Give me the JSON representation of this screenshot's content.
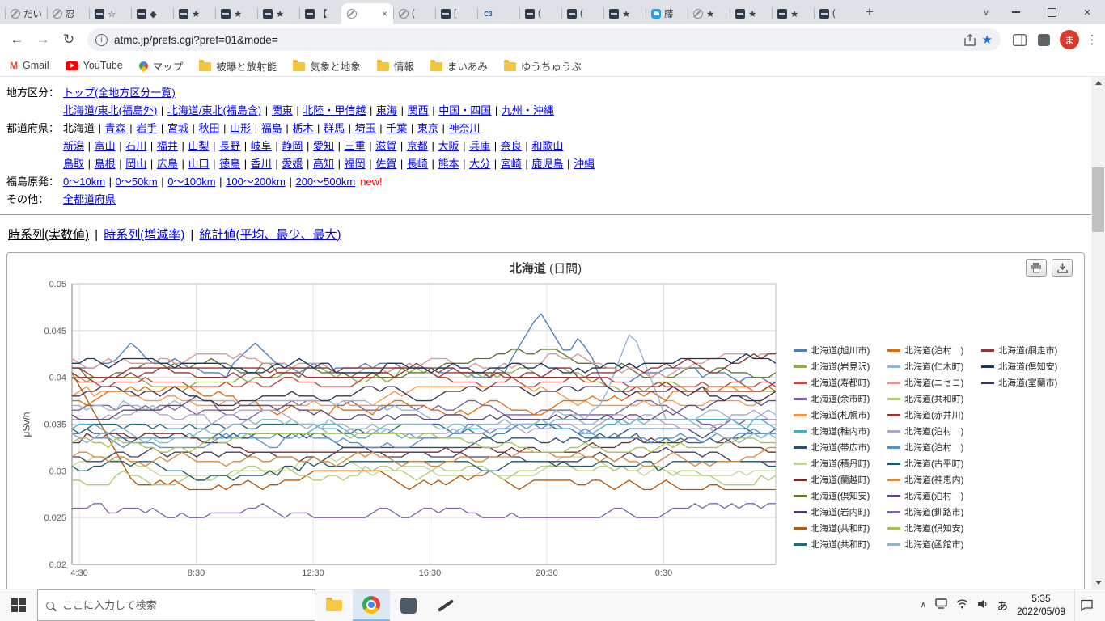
{
  "browser": {
    "window_controls": {
      "close": "×",
      "tab_chevron": "∨"
    },
    "glyphs": {
      "back": "←",
      "forward": "→",
      "reload": "↻",
      "star": "★",
      "new_tab": "+",
      "close_tab": "×"
    },
    "url": "atmc.jp/prefs.cgi?pref=01&mode=",
    "avatar_text": "ま",
    "tabs": [
      {
        "icon": "globe",
        "label": "だい",
        "active": false
      },
      {
        "icon": "globe",
        "label": "忍",
        "active": false
      },
      {
        "icon": "board",
        "label": "☆",
        "active": false
      },
      {
        "icon": "board",
        "label": "◆",
        "active": false
      },
      {
        "icon": "board",
        "label": "★",
        "active": false
      },
      {
        "icon": "board",
        "label": "★",
        "active": false
      },
      {
        "icon": "board",
        "label": "★",
        "active": false
      },
      {
        "icon": "board",
        "label": "【",
        "active": false
      },
      {
        "icon": "globe",
        "label": "",
        "active": true
      },
      {
        "icon": "globe",
        "label": "(",
        "active": false
      },
      {
        "icon": "board",
        "label": "[",
        "active": false
      },
      {
        "icon": "c3",
        "label": "C3",
        "active": false
      },
      {
        "icon": "board",
        "label": "(",
        "active": false
      },
      {
        "icon": "board",
        "label": "(",
        "active": false
      },
      {
        "icon": "board",
        "label": "★",
        "active": false
      },
      {
        "icon": "twitter",
        "label": "藤",
        "active": false
      },
      {
        "icon": "globe",
        "label": "★",
        "active": false
      },
      {
        "icon": "board",
        "label": "★",
        "active": false
      },
      {
        "icon": "board",
        "label": "★",
        "active": false
      },
      {
        "icon": "board",
        "label": "(",
        "active": false
      }
    ],
    "bookmarks": [
      {
        "icon": "gmail",
        "label": "Gmail"
      },
      {
        "icon": "youtube",
        "label": "YouTube"
      },
      {
        "icon": "maps",
        "label": "マップ"
      },
      {
        "icon": "folder",
        "label": "被曝と放射能"
      },
      {
        "icon": "folder",
        "label": "気象と地象"
      },
      {
        "icon": "folder",
        "label": "情報"
      },
      {
        "icon": "folder",
        "label": "まいあみ"
      },
      {
        "icon": "folder",
        "label": "ゆうちゅうぶ"
      }
    ]
  },
  "page": {
    "region": {
      "label": "地方区分：",
      "line1": [
        "トップ(全地方区分一覧)"
      ],
      "line2": [
        "北海道/東北(福島外)",
        "北海道/東北(福島含)",
        "関東",
        "北陸・甲信越",
        "東海",
        "関西",
        "中国・四国",
        "九州・沖縄"
      ]
    },
    "pref": {
      "label": "都道府県：",
      "current": "北海道",
      "lines": [
        [
          "北海道",
          "青森",
          "岩手",
          "宮城",
          "秋田",
          "山形",
          "福島",
          "栃木",
          "群馬",
          "埼玉",
          "千葉",
          "東京",
          "神奈川"
        ],
        [
          "新潟",
          "富山",
          "石川",
          "福井",
          "山梨",
          "長野",
          "岐阜",
          "静岡",
          "愛知",
          "三重",
          "滋賀",
          "京都",
          "大阪",
          "兵庫",
          "奈良",
          "和歌山"
        ],
        [
          "鳥取",
          "島根",
          "岡山",
          "広島",
          "山口",
          "徳島",
          "香川",
          "愛媛",
          "高知",
          "福岡",
          "佐賀",
          "長崎",
          "熊本",
          "大分",
          "宮崎",
          "鹿児島",
          "沖縄"
        ]
      ]
    },
    "npp": {
      "label": "福島原発：",
      "links": [
        "0〜10km",
        "0〜50km",
        "0〜100km",
        "100〜200km",
        "200〜500km"
      ],
      "badge": "new!"
    },
    "other": {
      "label": "その他：",
      "links": [
        "全都道府県"
      ]
    },
    "views": {
      "current": "時系列(実数値)",
      "items": [
        "時系列(実数値)",
        "時系列(増減率)",
        "統計値(平均、最少、最大)"
      ]
    }
  },
  "chart_data": {
    "type": "line",
    "title": "北海道",
    "subtitle": "(日間)",
    "ylabel": "μSv/h",
    "ylim": [
      0.02,
      0.05
    ],
    "yticks": [
      0.05,
      0.045,
      0.04,
      0.035,
      0.03,
      0.025,
      0.02
    ],
    "xticks": [
      "4:30",
      "8:30",
      "12:30",
      "16:30",
      "20:30",
      "0:30"
    ],
    "x_hours_span": 24,
    "grid": true,
    "legend_position": "right",
    "legend_rows": 13,
    "series": [
      {
        "name": "北海道(旭川市)",
        "color": "#4E7CBF",
        "base": 0.0408,
        "amp": 0.0013,
        "peaks": [
          {
            "t": 0.085,
            "v": 0.0438,
            "w": 0.035
          },
          {
            "t": 0.26,
            "v": 0.0437,
            "w": 0.04
          },
          {
            "t": 0.665,
            "v": 0.047,
            "w": 0.05
          },
          {
            "t": 0.72,
            "v": 0.0443,
            "w": 0.03
          }
        ]
      },
      {
        "name": "北海道(岩見沢)",
        "color": "#8FAF4C",
        "base": 0.0398,
        "amp": 0.0012
      },
      {
        "name": "北海道(寿都町)",
        "color": "#BE4B48",
        "base": 0.0405,
        "amp": 0.0014
      },
      {
        "name": "北海道(余市町)",
        "color": "#7D60A0",
        "base": 0.036,
        "amp": 0.0013
      },
      {
        "name": "北海道(札幌市)",
        "color": "#F79646",
        "base": 0.038,
        "amp": 0.0012
      },
      {
        "name": "北海道(稚内市)",
        "color": "#4BACC6",
        "base": 0.0345,
        "amp": 0.0012
      },
      {
        "name": "北海道(帯広市)",
        "color": "#2C4D75",
        "base": 0.0335,
        "amp": 0.0012
      },
      {
        "name": "北海道(積丹町)",
        "color": "#C3D69B",
        "base": 0.0305,
        "amp": 0.001
      },
      {
        "name": "北海道(蘭越町)",
        "color": "#772C2A",
        "base": 0.033,
        "amp": 0.0012
      },
      {
        "name": "北海道(倶知安)",
        "color": "#5F7530",
        "base": 0.0415,
        "amp": 0.0013
      },
      {
        "name": "北海道(岩内町)",
        "color": "#4D3B62",
        "base": 0.032,
        "amp": 0.0012
      },
      {
        "name": "北海道(共和町)",
        "color": "#B65708",
        "base": 0.029,
        "amp": 0.001,
        "peaks": [
          {
            "t": 0.0,
            "v": 0.0405,
            "w": 0.085
          }
        ]
      },
      {
        "name": "北海道(共和町)",
        "color": "#276A7C",
        "base": 0.034,
        "amp": 0.0011
      },
      {
        "name": "北海道(泊村　)",
        "color": "#E36C0A",
        "base": 0.0375,
        "amp": 0.0013
      },
      {
        "name": "北海道(仁木町)",
        "color": "#95B3D7",
        "base": 0.0365,
        "amp": 0.0012,
        "peaks": [
          {
            "t": 0.795,
            "v": 0.0452,
            "w": 0.045
          }
        ]
      },
      {
        "name": "北海道(ニセコ)",
        "color": "#D99694",
        "base": 0.0412,
        "amp": 0.0012
      },
      {
        "name": "北海道(共和町)",
        "color": "#AFC97A",
        "base": 0.0295,
        "amp": 0.0008
      },
      {
        "name": "北海道(赤井川)",
        "color": "#943634",
        "base": 0.0398,
        "amp": 0.0013
      },
      {
        "name": "北海道(泊村　)",
        "color": "#B2A2C7",
        "base": 0.0352,
        "amp": 0.0012
      },
      {
        "name": "北海道(泊村　)",
        "color": "#558ED5",
        "base": 0.0338,
        "amp": 0.0012
      },
      {
        "name": "北海道(古平町)",
        "color": "#205867",
        "base": 0.0302,
        "amp": 0.001
      },
      {
        "name": "北海道(神恵内)",
        "color": "#D38B42",
        "base": 0.0318,
        "amp": 0.0011
      },
      {
        "name": "北海道(泊村　)",
        "color": "#604A7B",
        "base": 0.0368,
        "amp": 0.0012
      },
      {
        "name": "北海道(釧路市)",
        "color": "#8064A2",
        "base": 0.0256,
        "amp": 0.0007
      },
      {
        "name": "北海道(倶知安)",
        "color": "#A5C249",
        "base": 0.0332,
        "amp": 0.001
      },
      {
        "name": "北海道(函館市)",
        "color": "#8CB8C6",
        "base": 0.0342,
        "amp": 0.0011
      },
      {
        "name": "北海道(網走市)",
        "color": "#953735",
        "base": 0.0412,
        "amp": 0.0013
      },
      {
        "name": "北海道(倶知安)",
        "color": "#17375E",
        "base": 0.042,
        "amp": 0.0013
      },
      {
        "name": "北海道(室蘭市)",
        "color": "#3F3151",
        "base": 0.0378,
        "amp": 0.0012
      }
    ]
  },
  "taskbar": {
    "search_placeholder": "ここに入力して検索",
    "ime": "あ",
    "time": "5:35",
    "date": "2022/05/09"
  }
}
